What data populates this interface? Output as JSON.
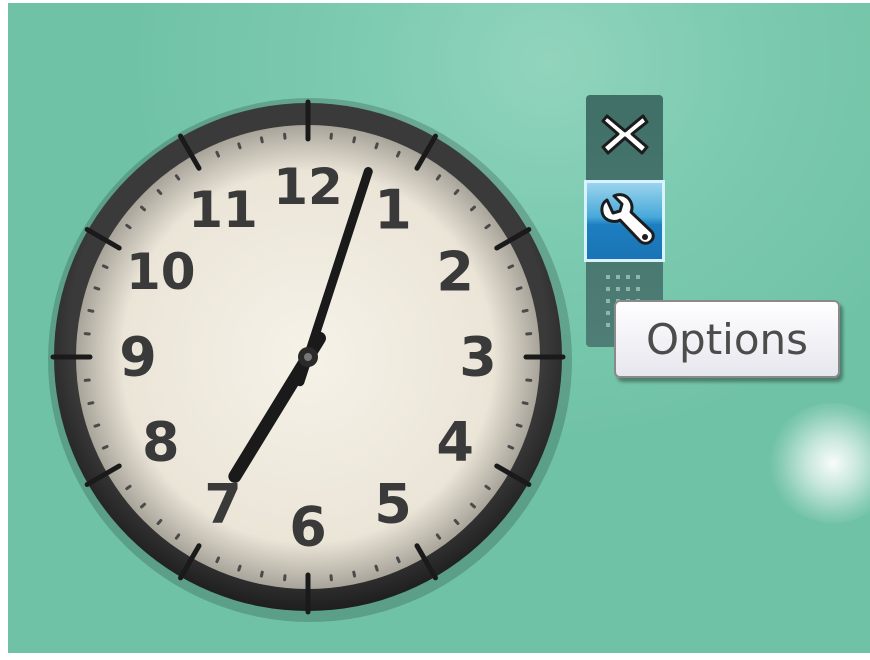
{
  "clock": {
    "numerals": [
      "12",
      "1",
      "2",
      "3",
      "4",
      "5",
      "6",
      "7",
      "8",
      "9",
      "10",
      "11"
    ],
    "time": {
      "hour": 7,
      "minute": 3
    }
  },
  "gadget_toolbar": {
    "close_icon": "close-x-icon",
    "options_icon": "wrench-icon",
    "drag_icon": "drag-dots-icon"
  },
  "tooltip": {
    "text": "Options"
  },
  "colors": {
    "desktop": "#7dcbb1",
    "bezel": "#2b2b2b",
    "dial": "#efeae0",
    "toolbar": "#46766e",
    "options_button": "#2a8fd0"
  }
}
